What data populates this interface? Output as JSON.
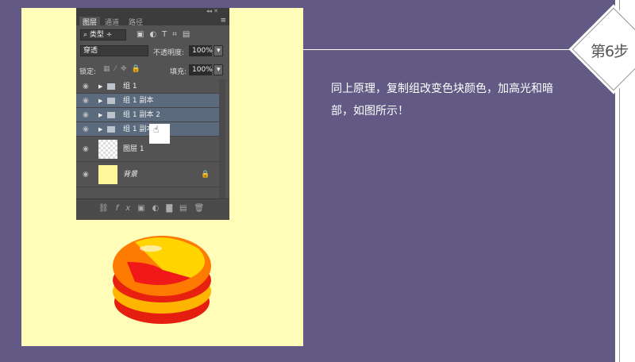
{
  "panel": {
    "tabs": [
      "图层",
      "通道",
      "路径"
    ],
    "filter_label": "类型",
    "blend_mode": "穿透",
    "opacity_label": "不透明度:",
    "opacity_value": "100%",
    "lock_label": "锁定:",
    "fill_label": "填充:",
    "fill_value": "100%",
    "layers": [
      {
        "name": "组 1",
        "type": "group",
        "selected": false
      },
      {
        "name": "组 1 副本",
        "type": "group",
        "selected": true
      },
      {
        "name": "组 1 副本 2",
        "type": "group",
        "selected": true
      },
      {
        "name": "组 1 副本",
        "type": "group",
        "selected": true
      },
      {
        "name": "图层 1",
        "type": "layer",
        "selected": false
      },
      {
        "name": "背景",
        "type": "background",
        "selected": false
      }
    ],
    "footer_fx": "fx"
  },
  "step": {
    "label": "第6步"
  },
  "description": "同上原理，复制组改变色块颜色，加高光和暗部，如图所示！",
  "colors": {
    "background": "#625a84",
    "canvas": "#fffdb8",
    "selection": "#5b6b7d"
  }
}
